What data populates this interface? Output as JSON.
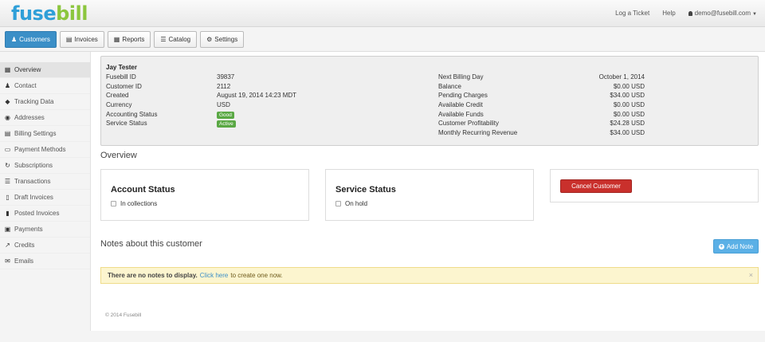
{
  "app": {
    "logo_main": "fusebill",
    "nav": {
      "log_ticket": "Log a Ticket",
      "help": "Help",
      "user": "demo@fusebill.com"
    }
  },
  "tabs": [
    {
      "label": "Customers",
      "icon": "user-icon"
    },
    {
      "label": "Invoices",
      "icon": "document-icon"
    },
    {
      "label": "Reports",
      "icon": "chart-icon"
    },
    {
      "label": "Catalog",
      "icon": "list-icon"
    },
    {
      "label": "Settings",
      "icon": "gear-icon"
    }
  ],
  "sidebar": {
    "items": [
      {
        "label": "Overview",
        "icon": "grid-icon"
      },
      {
        "label": "Contact",
        "icon": "user-icon"
      },
      {
        "label": "Tracking Data",
        "icon": "tag-icon"
      },
      {
        "label": "Addresses",
        "icon": "globe-icon"
      },
      {
        "label": "Billing Settings",
        "icon": "table-icon"
      },
      {
        "label": "Payment Methods",
        "icon": "credit-card-icon"
      },
      {
        "label": "Subscriptions",
        "icon": "refresh-icon"
      },
      {
        "label": "Transactions",
        "icon": "list-icon"
      },
      {
        "label": "Draft Invoices",
        "icon": "document-icon"
      },
      {
        "label": "Posted Invoices",
        "icon": "file-icon"
      },
      {
        "label": "Payments",
        "icon": "money-icon"
      },
      {
        "label": "Credits",
        "icon": "share-icon"
      },
      {
        "label": "Emails",
        "icon": "envelope-icon"
      }
    ]
  },
  "summary": {
    "name": "Jay Tester",
    "left": [
      {
        "label": "Fusebill ID",
        "value": "39837"
      },
      {
        "label": "Customer ID",
        "value": "2112"
      },
      {
        "label": "Created",
        "value": "August 19, 2014 14:23 MDT"
      },
      {
        "label": "Currency",
        "value": "USD"
      },
      {
        "label": "Accounting Status",
        "value": "Good"
      },
      {
        "label": "Service Status",
        "value": "Active"
      }
    ],
    "right": [
      {
        "label": "Next Billing Day",
        "value": "October 1, 2014"
      },
      {
        "label": "Balance",
        "value": "$0.00 USD"
      },
      {
        "label": "Pending Charges",
        "value": "$34.00 USD"
      },
      {
        "label": "Available Credit",
        "value": "$0.00 USD"
      },
      {
        "label": "Available Funds",
        "value": "$0.00 USD"
      },
      {
        "label": "Customer Profitability",
        "value": "$24.28 USD"
      },
      {
        "label": "Monthly Recurring Revenue",
        "value": "$34.00 USD"
      }
    ],
    "badge_color": "#5aa844"
  },
  "overview": {
    "title": "Overview",
    "account_status": {
      "title": "Account Status",
      "checkbox": "In collections"
    },
    "service_status": {
      "title": "Service Status",
      "checkbox": "On hold"
    },
    "cancel_button": "Cancel Customer"
  },
  "notes": {
    "title": "Notes about this customer",
    "add_button": "Add Note",
    "empty_bold": "There are no notes to display.",
    "link": "Click here",
    "rest": "to create one now.",
    "close": "×"
  },
  "footer": "© 2014 Fusebill",
  "colors": {
    "primary": "#3b8fc7",
    "danger": "#c9302c",
    "success": "#5aa844",
    "info": "#5bb0e6",
    "warning_bg": "#fcf5cf"
  }
}
